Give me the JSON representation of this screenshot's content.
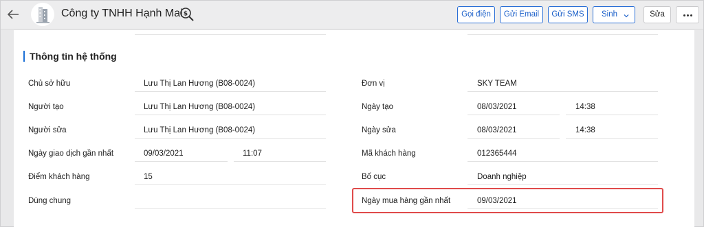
{
  "header": {
    "title": "Công ty TNHH Hạnh Mai",
    "buttons": {
      "call": "Gọi điện",
      "email": "Gửi Email",
      "sms": "Gửi SMS",
      "more": "Sinh",
      "edit": "Sửa"
    },
    "icons": [
      "back-arrow-icon",
      "company-building-icon",
      "dollar-search-icon",
      "chevron-down-icon",
      "more-dots-icon"
    ]
  },
  "section": {
    "title": "Thông tin hệ thống"
  },
  "left_fields": [
    {
      "label": "Chủ sở hữu",
      "value": "Lưu Thị Lan Hương (B08-0024)"
    },
    {
      "label": "Người tạo",
      "value": "Lưu Thị Lan Hương  (B08-0024)"
    },
    {
      "label": "Người sửa",
      "value": "Lưu Thị Lan Hương  (B08-0024)"
    },
    {
      "label": "Ngày giao dịch gần nhất",
      "date": "09/03/2021",
      "time": "11:07"
    },
    {
      "label": "Điểm khách hàng",
      "value": "15"
    },
    {
      "label": "Dùng chung",
      "value": ""
    }
  ],
  "right_fields": [
    {
      "label": "Đơn vị",
      "value": "SKY TEAM"
    },
    {
      "label": "Ngày tạo",
      "date": "08/03/2021",
      "time": "14:38"
    },
    {
      "label": "Ngày sửa",
      "date": "08/03/2021",
      "time": "14:38"
    },
    {
      "label": "Mã khách hàng",
      "value": "012365444"
    },
    {
      "label": "Bố cục",
      "value": "Doanh nghiệp"
    },
    {
      "label": "Ngày mua hàng gần nhất",
      "value": "09/03/2021"
    }
  ],
  "colors": {
    "accent": "#1a6fd6",
    "highlight": "#e04b4b",
    "background": "#e9e9ea"
  }
}
